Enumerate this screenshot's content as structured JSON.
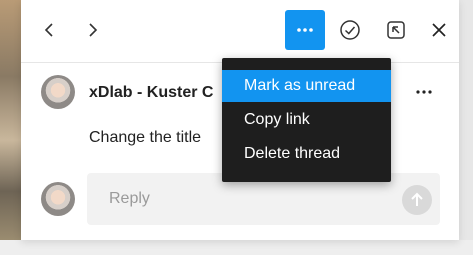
{
  "header": {
    "back_icon": "chevron-left-icon",
    "forward_icon": "chevron-right-icon",
    "more_label": "...",
    "resolve_icon": "check-circle-icon",
    "popout_icon": "popout-icon",
    "close_icon": "close-icon"
  },
  "comment": {
    "author": "xDlab - Kuster C",
    "text": "Change the title",
    "more_label": "..."
  },
  "reply": {
    "placeholder": "Reply",
    "send_icon": "arrow-up-icon"
  },
  "menu": {
    "items": [
      {
        "label": "Mark as unread",
        "highlighted": true
      },
      {
        "label": "Copy link"
      },
      {
        "label": "Delete thread"
      }
    ]
  },
  "colors": {
    "accent": "#1294f0",
    "menu_bg": "#1e1e1e",
    "reply_bg": "#f2f2f2"
  }
}
